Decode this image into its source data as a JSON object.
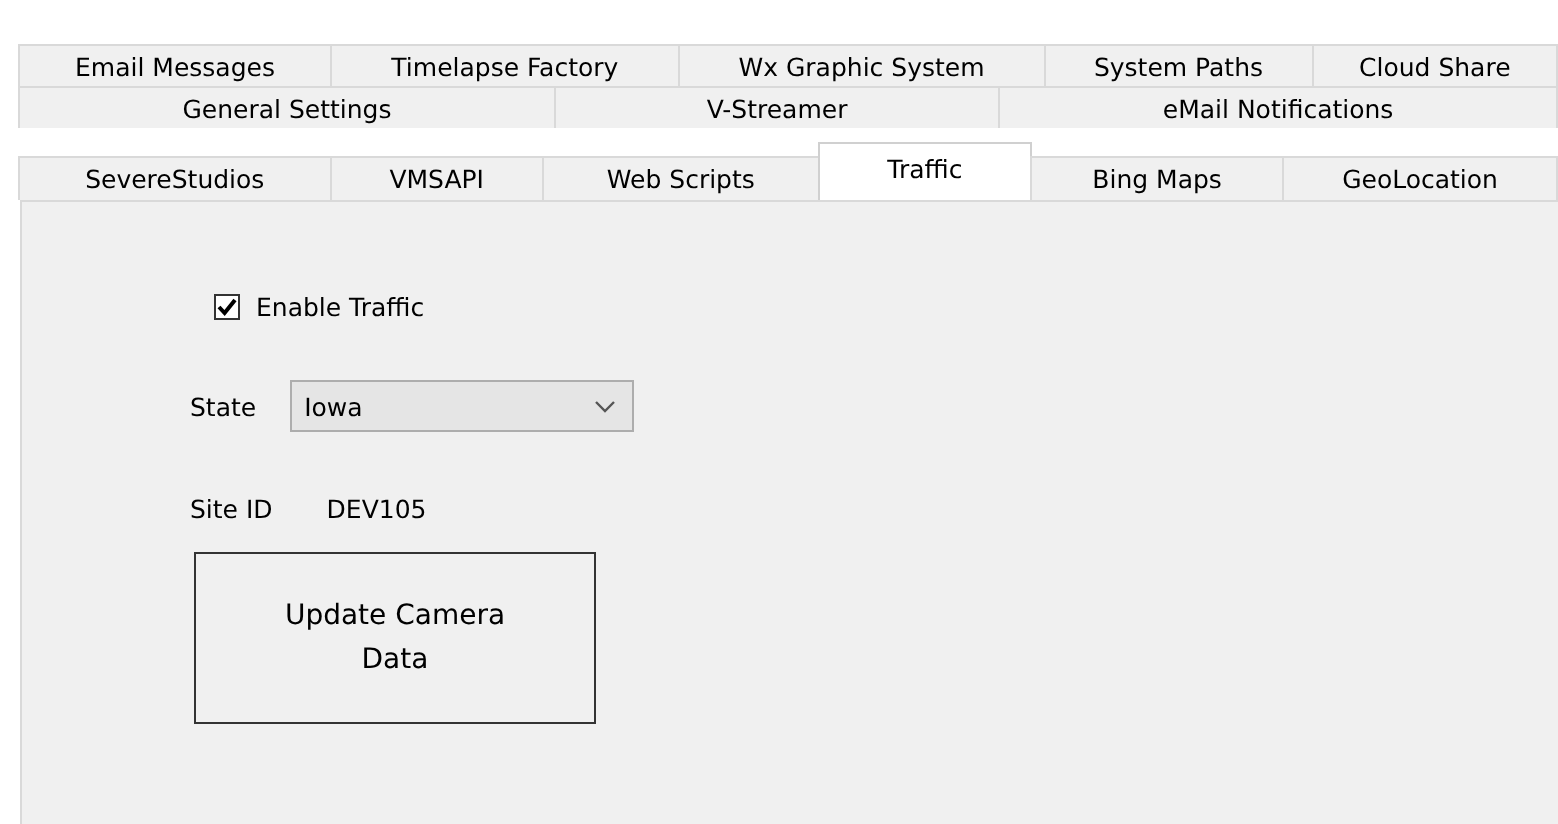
{
  "tab_rows": [
    [
      {
        "label": "Email Messages",
        "selected": false
      },
      {
        "label": "Timelapse Factory",
        "selected": false
      },
      {
        "label": "Wx Graphic System",
        "selected": false
      },
      {
        "label": "System Paths",
        "selected": false
      },
      {
        "label": "Cloud Share",
        "selected": false
      }
    ],
    [
      {
        "label": "General Settings",
        "selected": false
      },
      {
        "label": "V-Streamer",
        "selected": false
      },
      {
        "label": "eMail Notifications",
        "selected": false
      }
    ],
    [
      {
        "label": "SevereStudios",
        "selected": false
      },
      {
        "label": "VMSAPI",
        "selected": false
      },
      {
        "label": "Web Scripts",
        "selected": false
      },
      {
        "label": "Traffic",
        "selected": true
      },
      {
        "label": "Bing Maps",
        "selected": false
      },
      {
        "label": "GeoLocation",
        "selected": false
      }
    ]
  ],
  "enable_traffic": {
    "label": "Enable Traffic",
    "checked": true
  },
  "state": {
    "label": "State",
    "value": "Iowa"
  },
  "site_id": {
    "label": "Site ID",
    "value": "DEV105"
  },
  "update_button": {
    "label": "Update Camera Data"
  }
}
